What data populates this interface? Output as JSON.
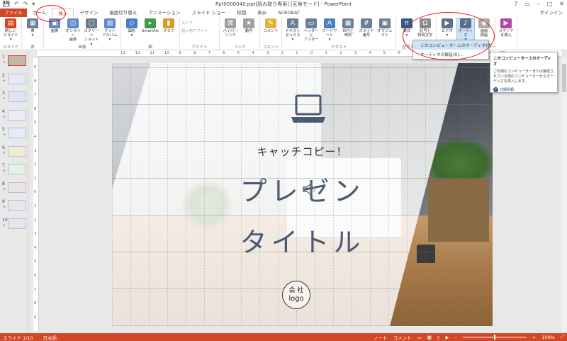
{
  "window": {
    "title": "Ppt0000040.ppt[読み取り専用] [互換モード] - PowerPoint",
    "controls": [
      "?",
      "▭",
      "–",
      "□",
      "✕"
    ]
  },
  "qat": [
    "💾",
    "↶",
    "↷",
    "▾"
  ],
  "tabs": [
    {
      "label": "ファイル",
      "kind": "file"
    },
    {
      "label": "ホーム",
      "kind": ""
    },
    {
      "label": "挿入",
      "kind": "active"
    },
    {
      "label": "デザイン",
      "kind": ""
    },
    {
      "label": "画面切り替え",
      "kind": ""
    },
    {
      "label": "アニメーション",
      "kind": ""
    },
    {
      "label": "スライド ショー",
      "kind": ""
    },
    {
      "label": "校閲",
      "kind": ""
    },
    {
      "label": "表示",
      "kind": ""
    },
    {
      "label": "ACROBAT",
      "kind": ""
    }
  ],
  "signin": "サインイン",
  "ribbon": {
    "groups": [
      {
        "label": "スライド",
        "buttons": [
          {
            "label": "新しい\nスライド ▾",
            "icon": "new-slide-icon",
            "color": "#d24726",
            "glyph": "▤"
          }
        ]
      },
      {
        "label": "表",
        "buttons": [
          {
            "label": "表\n▾",
            "icon": "table-icon",
            "color": "#6b7f99",
            "glyph": "▦"
          }
        ]
      },
      {
        "label": "画像",
        "buttons": [
          {
            "label": "画像",
            "icon": "picture-icon",
            "color": "#5b8ac4",
            "glyph": "▣"
          },
          {
            "label": "オンライン\n画像",
            "icon": "online-picture-icon",
            "color": "#5b8ac4",
            "glyph": "◫"
          },
          {
            "label": "スクリーン\nショット ▾",
            "icon": "screenshot-icon",
            "color": "#6c7a89",
            "glyph": "▢"
          },
          {
            "label": "フォト\nアルバム ▾",
            "icon": "photo-album-icon",
            "color": "#5b8ac4",
            "glyph": "▨"
          }
        ]
      },
      {
        "label": "図",
        "buttons": [
          {
            "label": "図形\n▾",
            "icon": "shapes-icon",
            "color": "#4a7fc1",
            "glyph": "◇"
          },
          {
            "label": "SmartArt",
            "icon": "smartart-icon",
            "color": "#3f9b4a",
            "glyph": "▸"
          },
          {
            "label": "グラフ",
            "icon": "chart-icon",
            "color": "#d69b2d",
            "glyph": "▮"
          }
        ]
      },
      {
        "label": "アドイン",
        "small": [
          "ストア",
          "個人用アプリ ▾"
        ]
      },
      {
        "label": "リンク",
        "buttons": [
          {
            "label": "ハイパーリンク",
            "icon": "hyperlink-icon",
            "color": "#a0a0a0",
            "glyph": "⌘"
          },
          {
            "label": "動作",
            "icon": "action-icon",
            "color": "#a0a0a0",
            "glyph": "★"
          }
        ]
      },
      {
        "label": "コメント",
        "buttons": [
          {
            "label": "コメント",
            "icon": "comment-icon",
            "color": "#e3b341",
            "glyph": "✎"
          }
        ]
      },
      {
        "label": "テキスト",
        "buttons": [
          {
            "label": "テキスト\nボックス ▾",
            "icon": "textbox-icon",
            "color": "#6b7f99",
            "glyph": "A"
          },
          {
            "label": "ヘッダーと\nフッター",
            "icon": "header-footer-icon",
            "color": "#6b7f99",
            "glyph": "▭"
          },
          {
            "label": "ワードアート\n▾",
            "icon": "wordart-icon",
            "color": "#4a7fc1",
            "glyph": "A"
          },
          {
            "label": "日付と\n時刻",
            "icon": "date-time-icon",
            "color": "#6b7f99",
            "glyph": "▦"
          },
          {
            "label": "スライド番号",
            "icon": "slide-number-icon",
            "color": "#6b7f99",
            "glyph": "#"
          },
          {
            "label": "オブジェクト",
            "icon": "object-icon",
            "color": "#6b7f99",
            "glyph": "▣"
          }
        ]
      },
      {
        "label": "記号と特殊文字",
        "buttons": [
          {
            "label": "数式\n▾",
            "icon": "equation-icon",
            "color": "#2f5a8f",
            "glyph": "π"
          },
          {
            "label": "記号と\n特殊文字",
            "icon": "symbol-icon",
            "color": "#8a8a8a",
            "glyph": "Ω"
          }
        ]
      },
      {
        "label": "メディア",
        "buttons": [
          {
            "label": "ビデオ\n▾",
            "icon": "video-icon",
            "color": "#5b6f8a",
            "glyph": "▶"
          },
          {
            "label": "オーディオ\n▾",
            "icon": "audio-icon",
            "color": "#5b6f8a",
            "glyph": "♪",
            "highlight": true
          },
          {
            "label": "画面\n録画",
            "icon": "screen-recording-icon",
            "color": "#aaaaaa",
            "glyph": "◉"
          }
        ]
      },
      {
        "label": "",
        "buttons": [
          {
            "label": "メディア\nを挿入",
            "icon": "insert-media-icon",
            "color": "#b04aa0",
            "glyph": "▶"
          }
        ]
      }
    ]
  },
  "audio_menu": {
    "items": [
      "このコンピューター上のオーディオ(P)...",
      "オーディオの録音(R)..."
    ]
  },
  "tooltip": {
    "title": "このコンピューター上のオーディオ",
    "body": "ご利用のコンピューターまたは接続されている他のコンピューターからオーディオを挿入します。",
    "more": "詳細情報"
  },
  "thumbnails": [
    "1",
    "2",
    "3",
    "4",
    "5",
    "6",
    "7",
    "8",
    "9",
    "10"
  ],
  "thumb_colors": [
    "#c5b7a8",
    "#e6eaf2",
    "#dbe6f4",
    "#e7eef7",
    "#e3ecf7",
    "#f0ead6",
    "#e4f1e5",
    "#ede3e3",
    "#e5e8f1",
    "#dfe7f3"
  ],
  "ruler_h": [
    "13",
    "12",
    "11",
    "10",
    "9",
    "8",
    "7",
    "6",
    "5",
    "4",
    "3",
    "2",
    "1",
    "0",
    "1",
    "2",
    "3",
    "4",
    "5",
    "6",
    "7",
    "8",
    "9",
    "10",
    "11",
    "12",
    "13"
  ],
  "ruler_v": [
    "9",
    "8",
    "7",
    "6",
    "5",
    "4",
    "3",
    "2",
    "1",
    "0",
    "1",
    "2",
    "3",
    "4",
    "5",
    "6",
    "7",
    "8",
    "9"
  ],
  "slide": {
    "catch": "キャッチコピー！",
    "title_line1": "プレゼン",
    "title_line2": "タイトル",
    "logo_line1": "会 社",
    "logo_line2": "logo"
  },
  "status": {
    "slide": "スライド 1/10",
    "lang": "日本語",
    "notes": "ノート",
    "comments": "コメント",
    "zoom": "109%"
  },
  "accent": "#d24726"
}
